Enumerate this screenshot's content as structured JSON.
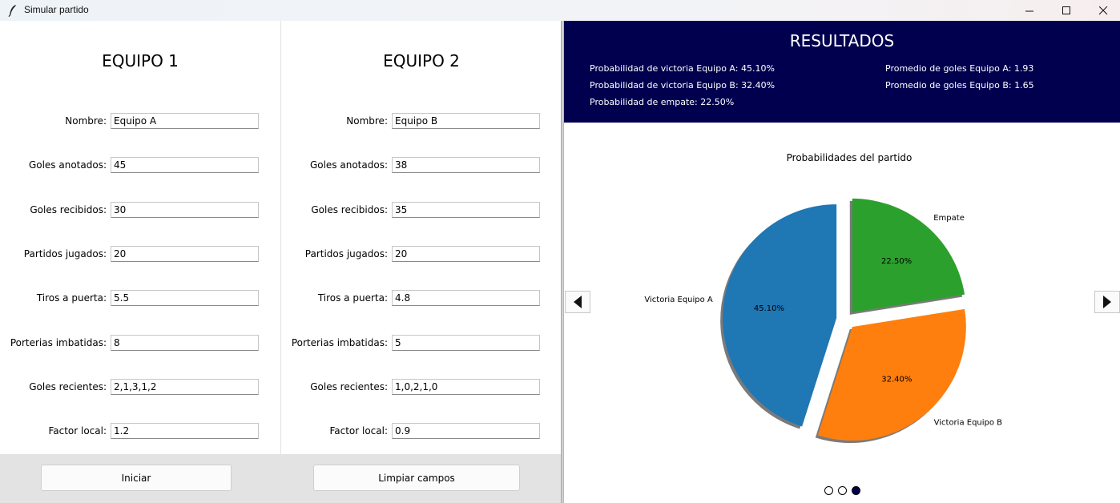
{
  "window": {
    "title": "Simular partido",
    "icon": "feather-icon"
  },
  "team1": {
    "title": "EQUIPO 1",
    "fields": [
      {
        "label": "Nombre:",
        "value": "Equipo A"
      },
      {
        "label": "Goles anotados:",
        "value": "45"
      },
      {
        "label": "Goles recibidos:",
        "value": "30"
      },
      {
        "label": "Partidos jugados:",
        "value": "20"
      },
      {
        "label": "Tiros a puerta:",
        "value": "5.5"
      },
      {
        "label": "Porterias imbatidas:",
        "value": "8"
      },
      {
        "label": "Goles recientes:",
        "value": "2,1,3,1,2"
      },
      {
        "label": "Factor local:",
        "value": "1.2"
      }
    ]
  },
  "team2": {
    "title": "EQUIPO 2",
    "fields": [
      {
        "label": "Nombre:",
        "value": "Equipo B"
      },
      {
        "label": "Goles anotados:",
        "value": "38"
      },
      {
        "label": "Goles recibidos:",
        "value": "35"
      },
      {
        "label": "Partidos jugados:",
        "value": "20"
      },
      {
        "label": "Tiros a puerta:",
        "value": "4.8"
      },
      {
        "label": "Porterias imbatidas:",
        "value": "5"
      },
      {
        "label": "Goles recientes:",
        "value": "1,0,2,1,0"
      },
      {
        "label": "Factor local:",
        "value": "0.9"
      }
    ]
  },
  "buttons": {
    "start": "Iniciar",
    "clear": "Limpiar campos"
  },
  "results": {
    "title": "RESULTADOS",
    "prob_a": "Probabilidad de victoria Equipo A: 45.10%",
    "prob_b": "Probabilidad de victoria Equipo B: 32.40%",
    "prob_draw": "Probabilidad de empate: 22.50%",
    "avg_a": "Promedio de goles Equipo A: 1.93",
    "avg_b": "Promedio de goles Equipo B: 1.65",
    "header_color": "#00004f"
  },
  "carousel": {
    "pages": 3,
    "active_page": 3
  },
  "chart_data": {
    "type": "pie",
    "title": "Probabilidades del partido",
    "slices": [
      {
        "label": "Victoria Equipo A",
        "value": 45.1,
        "pct_label": "45.10%",
        "color": "#1f77b4"
      },
      {
        "label": "Victoria Equipo B",
        "value": 32.4,
        "pct_label": "32.40%",
        "color": "#ff7f0e"
      },
      {
        "label": "Empate",
        "value": 22.5,
        "pct_label": "22.50%",
        "color": "#2ca02c"
      }
    ],
    "start_angle_deg": 90,
    "explode": true,
    "shadow": true
  }
}
